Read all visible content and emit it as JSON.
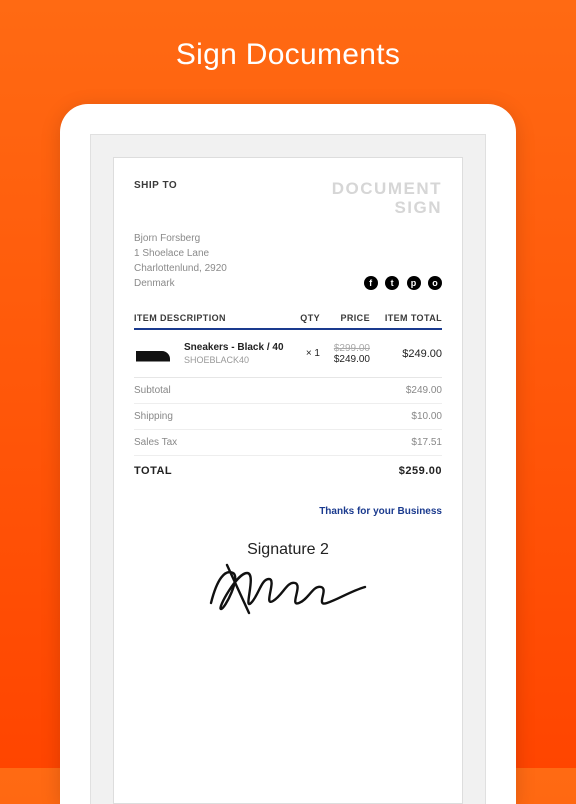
{
  "hero": {
    "title": "Sign Documents"
  },
  "doc": {
    "ship_label": "SHIP TO",
    "watermark_line1": "DOCUMENT",
    "watermark_line2": "SIGN",
    "address": {
      "name": "Bjorn Forsberg",
      "line1": "1 Shoelace Lane",
      "line2": "Charlottenlund, 2920",
      "country": "Denmark"
    },
    "socials": [
      "f",
      "t",
      "p",
      "o"
    ],
    "headers": {
      "desc": "ITEM DESCRIPTION",
      "qty": "QTY",
      "price": "PRICE",
      "total": "ITEM TOTAL"
    },
    "item": {
      "title": "Sneakers - Black / 40",
      "sku": "SHOEBLACK40",
      "qty": "× 1",
      "price_original": "$299.00",
      "price_current": "$249.00",
      "line_total": "$249.00"
    },
    "subtotal_label": "Subtotal",
    "subtotal_value": "$249.00",
    "shipping_label": "Shipping",
    "shipping_value": "$10.00",
    "tax_label": "Sales Tax",
    "tax_value": "$17.51",
    "total_label": "TOTAL",
    "total_value": "$259.00",
    "thanks": "Thanks for your Business",
    "signature_label": "Signature 2"
  }
}
